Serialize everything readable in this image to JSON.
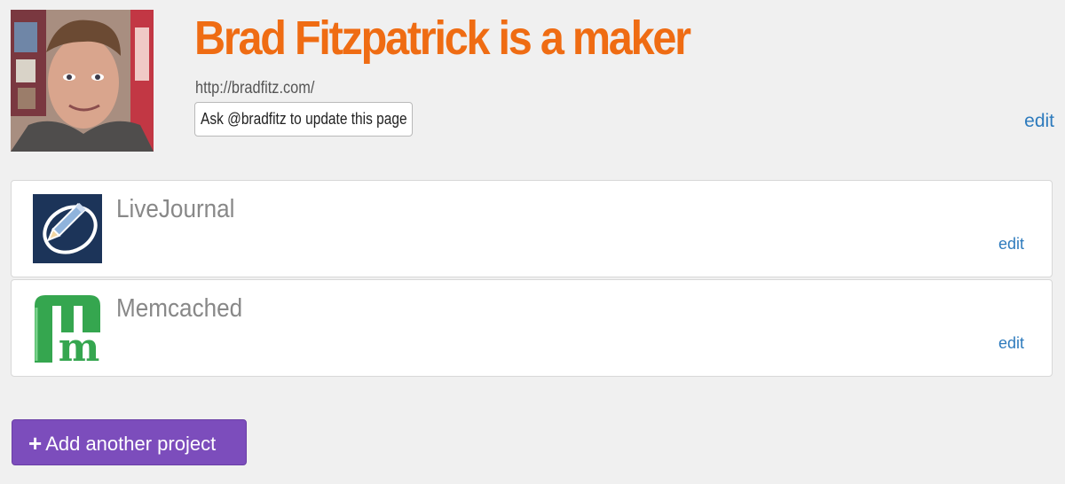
{
  "profile": {
    "name_title": "Brad Fitzpatrick is a maker",
    "url": "http://bradfitz.com/",
    "ask_button_label": "Ask @bradfitz to update this page",
    "edit_label": "edit"
  },
  "projects": [
    {
      "name": "LiveJournal",
      "edit_label": "edit",
      "icon": "livejournal-logo"
    },
    {
      "name": "Memcached",
      "edit_label": "edit",
      "icon": "memcached-logo"
    }
  ],
  "add_project": {
    "icon": "plus-icon",
    "label": "Add another project"
  },
  "colors": {
    "title": "#ef6c13",
    "link": "#2e7bbd",
    "add_button": "#7c4dbc",
    "memcached_green": "#35a64f",
    "livejournal_navy": "#1c3459"
  }
}
